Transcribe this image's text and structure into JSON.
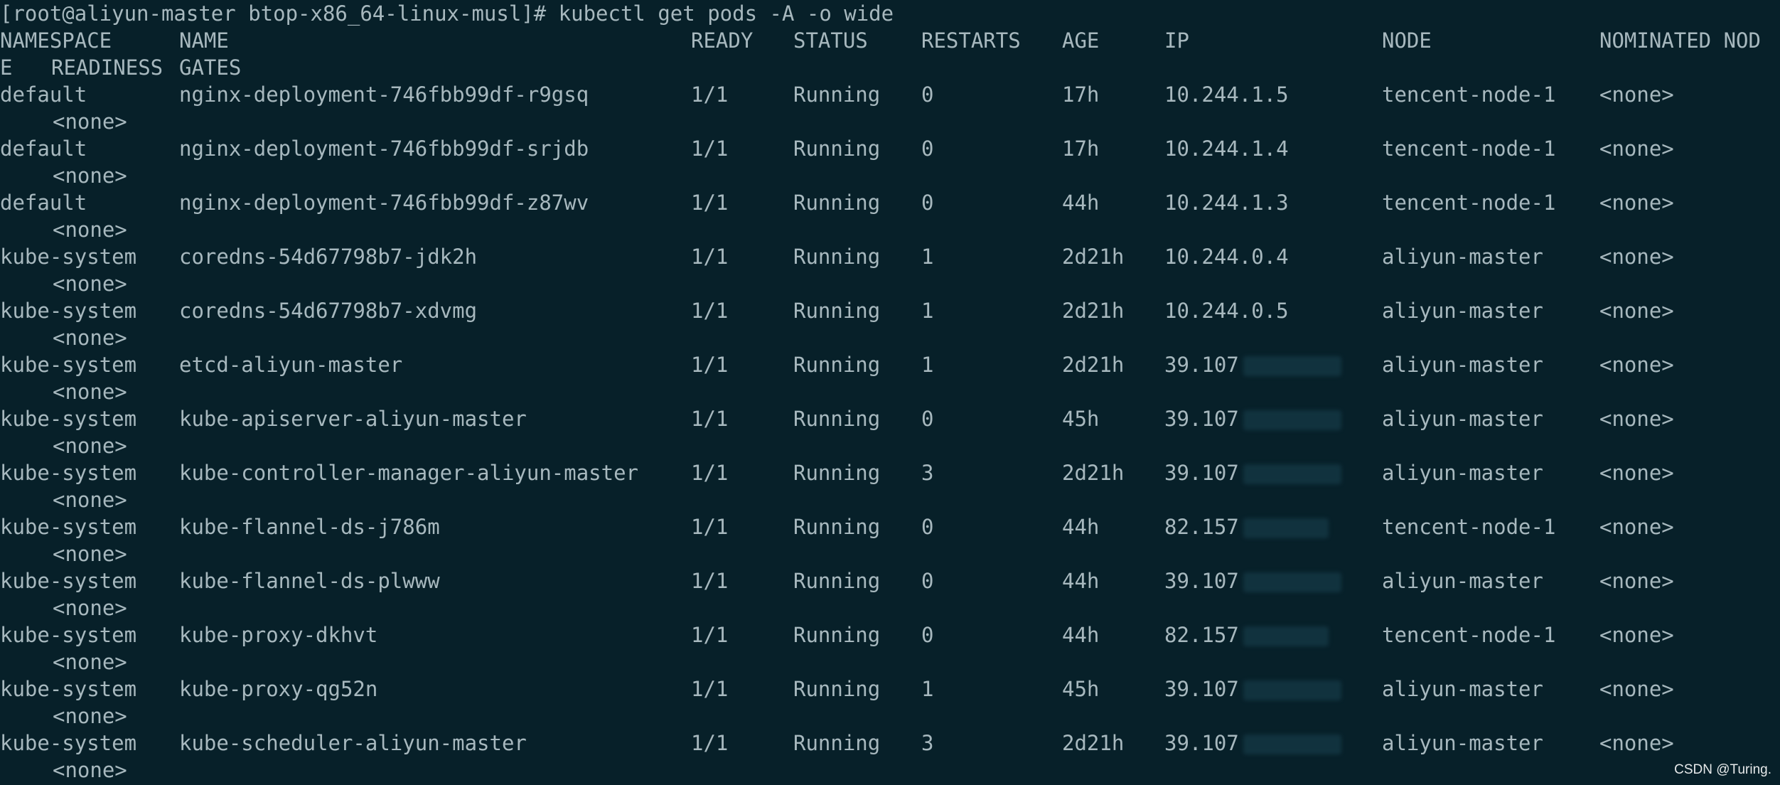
{
  "prompt": "[root@aliyun-master btop-x86_64-linux-musl]# kubectl get pods -A -o wide",
  "headers": {
    "namespace": "NAMESPACE",
    "name": "NAME",
    "ready": "READY",
    "status": "STATUS",
    "restarts": "RESTARTS",
    "age": "AGE",
    "ip": "IP",
    "node": "NODE",
    "nominated": "NOMINATED NOD",
    "wrap_e": "E",
    "readiness": "READINESS",
    "gates": "GATES"
  },
  "rows": [
    {
      "namespace": "default",
      "name": "nginx-deployment-746fbb99df-r9gsq",
      "ready": "1/1",
      "status": "Running",
      "restarts": "0",
      "age": "17h",
      "ip": "10.244.1.5",
      "ip_redacted": false,
      "node": "tencent-node-1",
      "nominated": "<none>",
      "readiness": "<none>"
    },
    {
      "namespace": "default",
      "name": "nginx-deployment-746fbb99df-srjdb",
      "ready": "1/1",
      "status": "Running",
      "restarts": "0",
      "age": "17h",
      "ip": "10.244.1.4",
      "ip_redacted": false,
      "node": "tencent-node-1",
      "nominated": "<none>",
      "readiness": "<none>"
    },
    {
      "namespace": "default",
      "name": "nginx-deployment-746fbb99df-z87wv",
      "ready": "1/1",
      "status": "Running",
      "restarts": "0",
      "age": "44h",
      "ip": "10.244.1.3",
      "ip_redacted": false,
      "node": "tencent-node-1",
      "nominated": "<none>",
      "readiness": "<none>"
    },
    {
      "namespace": "kube-system",
      "name": "coredns-54d67798b7-jdk2h",
      "ready": "1/1",
      "status": "Running",
      "restarts": "1",
      "age": "2d21h",
      "ip": "10.244.0.4",
      "ip_redacted": false,
      "node": "aliyun-master",
      "nominated": "<none>",
      "readiness": "<none>"
    },
    {
      "namespace": "kube-system",
      "name": "coredns-54d67798b7-xdvmg",
      "ready": "1/1",
      "status": "Running",
      "restarts": "1",
      "age": "2d21h",
      "ip": "10.244.0.5",
      "ip_redacted": false,
      "node": "aliyun-master",
      "nominated": "<none>",
      "readiness": "<none>"
    },
    {
      "namespace": "kube-system",
      "name": "etcd-aliyun-master",
      "ready": "1/1",
      "status": "Running",
      "restarts": "1",
      "age": "2d21h",
      "ip": "39.107",
      "ip_redacted": true,
      "node": "aliyun-master",
      "nominated": "<none>",
      "readiness": "<none>"
    },
    {
      "namespace": "kube-system",
      "name": "kube-apiserver-aliyun-master",
      "ready": "1/1",
      "status": "Running",
      "restarts": "0",
      "age": "45h",
      "ip": "39.107",
      "ip_redacted": true,
      "node": "aliyun-master",
      "nominated": "<none>",
      "readiness": "<none>"
    },
    {
      "namespace": "kube-system",
      "name": "kube-controller-manager-aliyun-master",
      "ready": "1/1",
      "status": "Running",
      "restarts": "3",
      "age": "2d21h",
      "ip": "39.107",
      "ip_redacted": true,
      "node": "aliyun-master",
      "nominated": "<none>",
      "readiness": "<none>"
    },
    {
      "namespace": "kube-system",
      "name": "kube-flannel-ds-j786m",
      "ready": "1/1",
      "status": "Running",
      "restarts": "0",
      "age": "44h",
      "ip": "82.157",
      "ip_redacted": true,
      "node": "tencent-node-1",
      "nominated": "<none>",
      "readiness": "<none>"
    },
    {
      "namespace": "kube-system",
      "name": "kube-flannel-ds-plwww",
      "ready": "1/1",
      "status": "Running",
      "restarts": "0",
      "age": "44h",
      "ip": "39.107",
      "ip_redacted": true,
      "node": "aliyun-master",
      "nominated": "<none>",
      "readiness": "<none>"
    },
    {
      "namespace": "kube-system",
      "name": "kube-proxy-dkhvt",
      "ready": "1/1",
      "status": "Running",
      "restarts": "0",
      "age": "44h",
      "ip": "82.157",
      "ip_redacted": true,
      "node": "tencent-node-1",
      "nominated": "<none>",
      "readiness": "<none>"
    },
    {
      "namespace": "kube-system",
      "name": "kube-proxy-qg52n",
      "ready": "1/1",
      "status": "Running",
      "restarts": "1",
      "age": "45h",
      "ip": "39.107",
      "ip_redacted": true,
      "node": "aliyun-master",
      "nominated": "<none>",
      "readiness": "<none>"
    },
    {
      "namespace": "kube-system",
      "name": "kube-scheduler-aliyun-master",
      "ready": "1/1",
      "status": "Running",
      "restarts": "3",
      "age": "2d21h",
      "ip": "39.107",
      "ip_redacted": true,
      "node": "aliyun-master",
      "nominated": "<none>",
      "readiness": "<none>"
    }
  ],
  "watermark": "CSDN @Turing.",
  "colors": {
    "background": "#072029",
    "text": "#a7b8be",
    "watermark": "#ffffff"
  }
}
